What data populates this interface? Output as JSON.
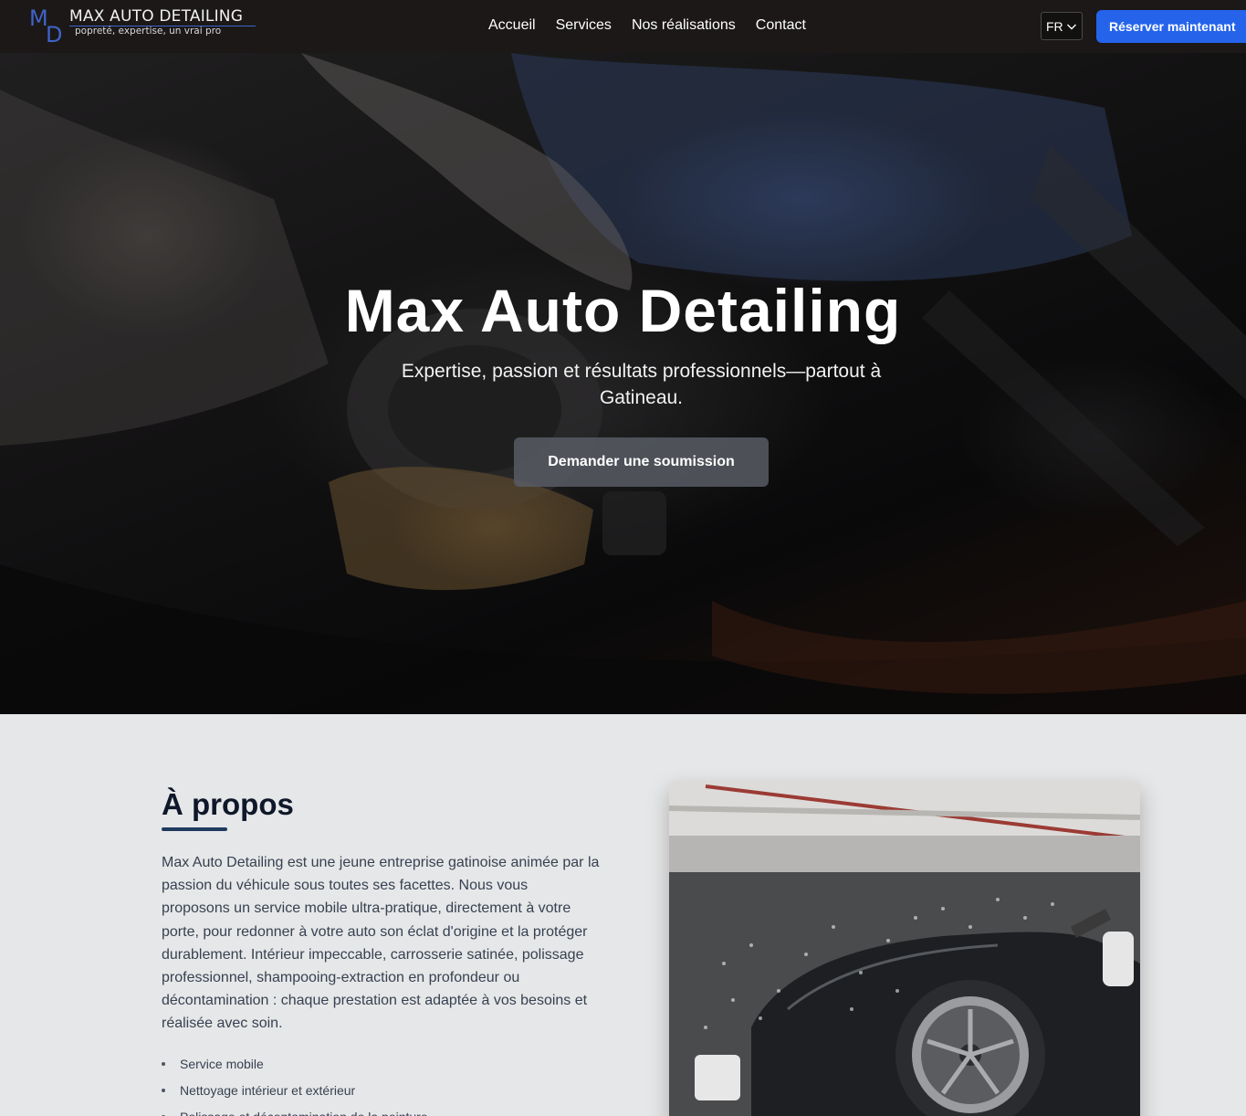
{
  "header": {
    "logo": {
      "letter_m": "M",
      "letter_d": "D",
      "title": "MAX AUTO DETAILING",
      "tagline": "popreté, expertise, un vrai pro"
    },
    "nav": [
      "Accueil",
      "Services",
      "Nos réalisations",
      "Contact"
    ],
    "language": "FR",
    "book_button": "Réserver maintenant",
    "colors": {
      "background": "#1b1817",
      "accent": "#2563eb",
      "logo_blue": "#3f63c9"
    }
  },
  "hero": {
    "title": "Max Auto Detailing",
    "subtitle": "Expertise, passion et résultats professionnels—partout à Gatineau.",
    "cta": "Demander une soumission"
  },
  "about": {
    "title": "À propos",
    "text": "Max Auto Detailing est une jeune entreprise gatinoise animée par la passion du véhicule sous toutes ses facettes. Nous vous proposons un service mobile ultra-pratique, directement à votre porte, pour redonner à votre auto son éclat d'origine et la protéger durablement. Intérieur impeccable, carrosserie satinée, polissage professionnel, shampooing-extraction en profondeur ou décontamination : chaque prestation est adaptée à vos besoins et réalisée avec soin.",
    "list": [
      "Service mobile",
      "Nettoyage intérieur et extérieur",
      "Polissage et décontamination de la peinture"
    ]
  }
}
